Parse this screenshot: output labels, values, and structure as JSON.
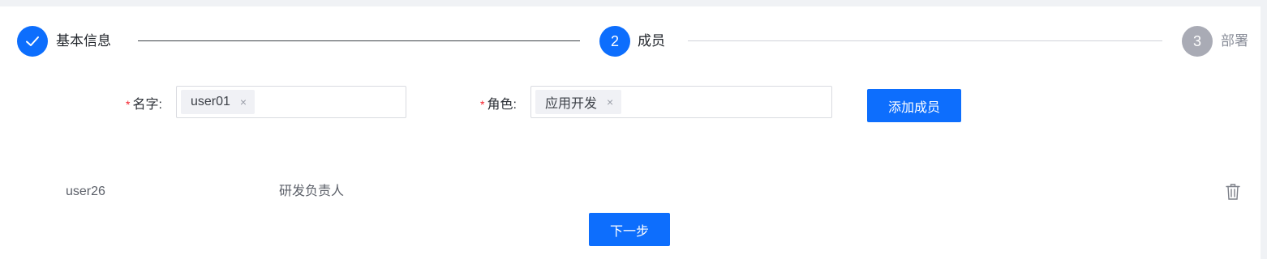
{
  "steps": [
    {
      "index": "1",
      "label": "基本信息",
      "status": "done",
      "icon": "check-icon"
    },
    {
      "index": "2",
      "label": "成员",
      "status": "active"
    },
    {
      "index": "3",
      "label": "部署",
      "status": "pending"
    }
  ],
  "form": {
    "name_label": "名字:",
    "name_tags": [
      {
        "label": "user01",
        "close": "×"
      }
    ],
    "role_label": "角色:",
    "role_tags": [
      {
        "label": "应用开发",
        "close": "×"
      }
    ],
    "required_mark": "*",
    "add_button": "添加成员"
  },
  "members": [
    {
      "name": "user26",
      "role": "研发负责人",
      "action_icon": "trash-icon"
    }
  ],
  "next_button": "下一步",
  "colors": {
    "primary": "#0d6efd",
    "pending": "#a9abb5",
    "required": "#f5222d"
  }
}
